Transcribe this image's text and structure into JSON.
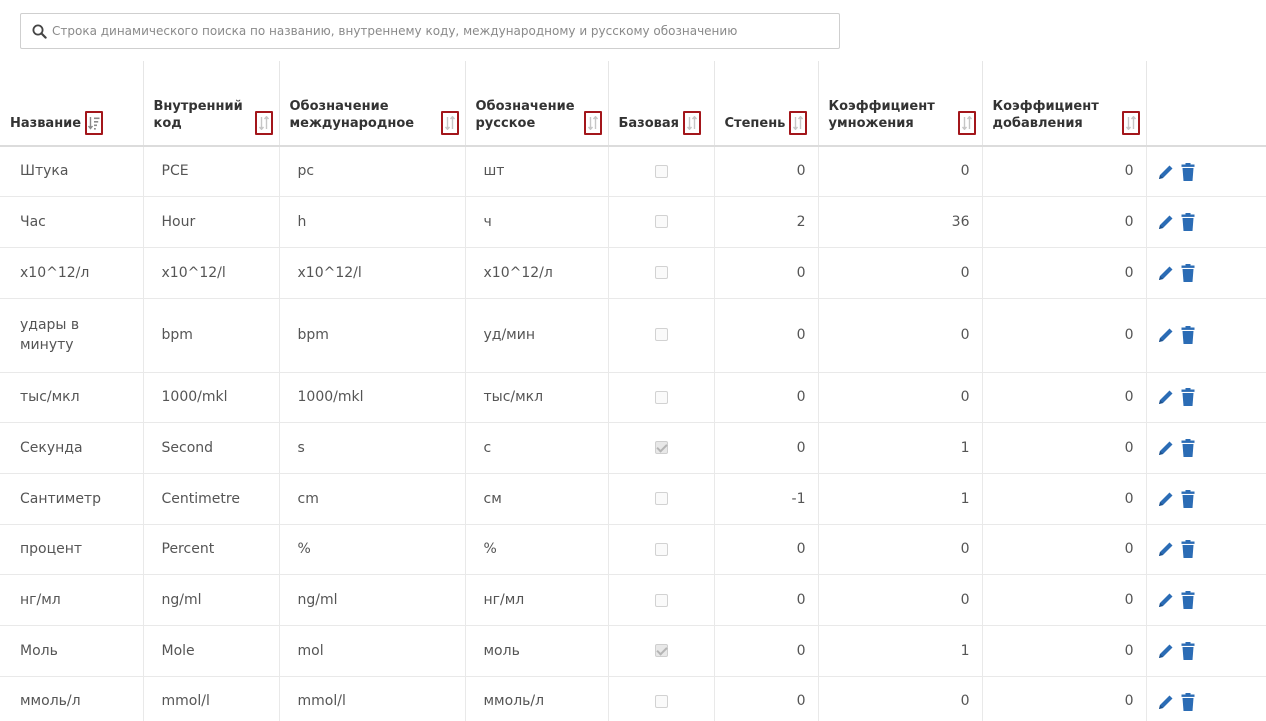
{
  "search": {
    "placeholder": "Строка динамического поиска по названию, внутреннему коду, международному и русскому обозначению",
    "value": ""
  },
  "columns": [
    {
      "label_lines": [
        "Название"
      ],
      "sort": "desc"
    },
    {
      "label_lines": [
        "Внутренний",
        "код"
      ],
      "sort": "none"
    },
    {
      "label_lines": [
        "Обозначение",
        "международное"
      ],
      "sort": "none"
    },
    {
      "label_lines": [
        "Обозначение",
        "русское"
      ],
      "sort": "none"
    },
    {
      "label_lines": [
        "Базовая"
      ],
      "sort": "none"
    },
    {
      "label_lines": [
        "Степень"
      ],
      "sort": "none"
    },
    {
      "label_lines": [
        "Коэффициент",
        "умножения"
      ],
      "sort": "none"
    },
    {
      "label_lines": [
        "Коэффициент",
        "добавления"
      ],
      "sort": "none"
    }
  ],
  "rows": [
    {
      "name": "Штука",
      "code": "PCE",
      "intl": "pc",
      "rus": "шт",
      "base": false,
      "power": "0",
      "mult": "0",
      "add": "0"
    },
    {
      "name": "Час",
      "code": "Hour",
      "intl": "h",
      "rus": "ч",
      "base": false,
      "power": "2",
      "mult": "36",
      "add": "0"
    },
    {
      "name": "x10^12/л",
      "code": "x10^12/l",
      "intl": "x10^12/l",
      "rus": "x10^12/л",
      "base": false,
      "power": "0",
      "mult": "0",
      "add": "0"
    },
    {
      "name": "удары в минуту",
      "code": "bpm",
      "intl": "bpm",
      "rus": "уд/мин",
      "base": false,
      "power": "0",
      "mult": "0",
      "add": "0"
    },
    {
      "name": "тыс/мкл",
      "code": "1000/mkl",
      "intl": "1000/mkl",
      "rus": "тыс/мкл",
      "base": false,
      "power": "0",
      "mult": "0",
      "add": "0"
    },
    {
      "name": "Секунда",
      "code": "Second",
      "intl": "s",
      "rus": "с",
      "base": true,
      "power": "0",
      "mult": "1",
      "add": "0"
    },
    {
      "name": "Сантиметр",
      "code": "Centimetre",
      "intl": "cm",
      "rus": "см",
      "base": false,
      "power": "-1",
      "mult": "1",
      "add": "0"
    },
    {
      "name": "процент",
      "code": "Percent",
      "intl": "%",
      "rus": "%",
      "base": false,
      "power": "0",
      "mult": "0",
      "add": "0"
    },
    {
      "name": "нг/мл",
      "code": "ng/ml",
      "intl": "ng/ml",
      "rus": "нг/мл",
      "base": false,
      "power": "0",
      "mult": "0",
      "add": "0"
    },
    {
      "name": "Моль",
      "code": "Mole",
      "intl": "mol",
      "rus": "моль",
      "base": true,
      "power": "0",
      "mult": "1",
      "add": "0"
    },
    {
      "name": "ммоль/л",
      "code": "mmol/l",
      "intl": "mmol/l",
      "rus": "ммоль/л",
      "base": false,
      "power": "0",
      "mult": "0",
      "add": "0"
    }
  ],
  "icons": {
    "search": "search-icon",
    "sort_desc": "sort-descending-icon",
    "sort_none": "sort-icon",
    "edit": "pencil-icon",
    "delete": "trash-icon"
  },
  "colors": {
    "sort_border": "#a3161b",
    "action_icon": "#2b6cb5"
  }
}
